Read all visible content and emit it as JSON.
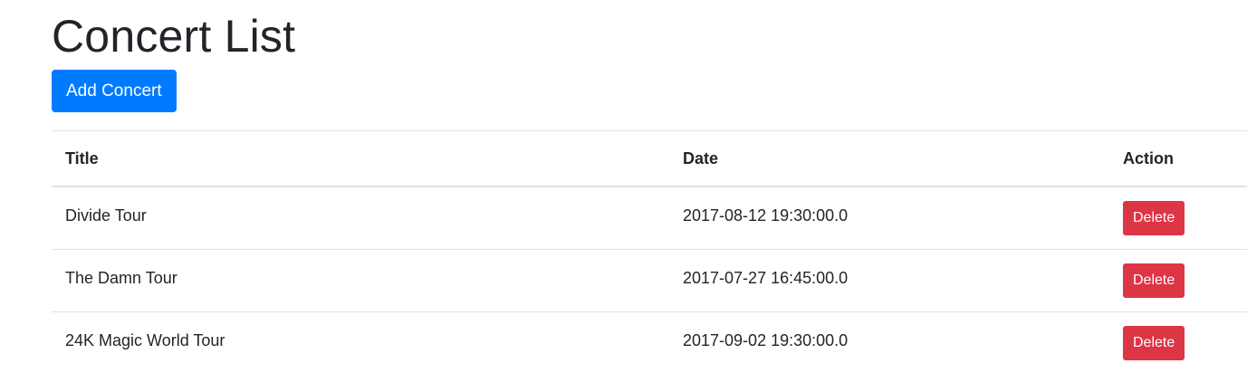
{
  "page": {
    "title": "Concert List"
  },
  "toolbar": {
    "add_label": "Add Concert"
  },
  "table": {
    "headers": {
      "title": "Title",
      "date": "Date",
      "action": "Action"
    },
    "rows": [
      {
        "title": "Divide Tour",
        "date": "2017-08-12 19:30:00.0",
        "action_label": "Delete"
      },
      {
        "title": "The Damn Tour",
        "date": "2017-07-27 16:45:00.0",
        "action_label": "Delete"
      },
      {
        "title": "24K Magic World Tour",
        "date": "2017-09-02 19:30:00.0",
        "action_label": "Delete"
      }
    ]
  },
  "colors": {
    "primary": "#007bff",
    "danger": "#dc3545",
    "text": "#212529",
    "border": "#dee2e6"
  }
}
